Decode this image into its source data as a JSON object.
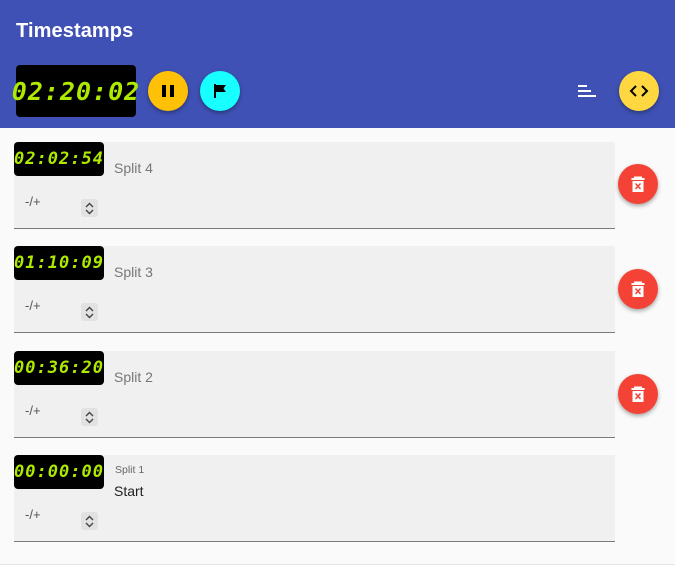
{
  "app": {
    "title": "Timestamps"
  },
  "toolbar": {
    "clock": "02:20:02",
    "pause_icon": "pause-icon",
    "flag_icon": "flag-icon",
    "sort_icon": "sort-lines-icon",
    "code_icon": "code-icon",
    "colors": {
      "header": "#3f51b5",
      "pause": "#ffc107",
      "flag": "#18ffff",
      "code": "#ffd740",
      "lcd_text": "#aeea00",
      "delete": "#f44336"
    }
  },
  "splits": [
    {
      "time": "02:02:54",
      "label": "Split 4",
      "value": "",
      "offset": "-/+"
    },
    {
      "time": "01:10:09",
      "label": "Split 3",
      "value": "",
      "offset": "-/+"
    },
    {
      "time": "00:36:20",
      "label": "Split 2",
      "value": "",
      "offset": "-/+"
    },
    {
      "time": "00:00:00",
      "label": "Split 1",
      "value": "Start",
      "offset": "-/+"
    }
  ]
}
